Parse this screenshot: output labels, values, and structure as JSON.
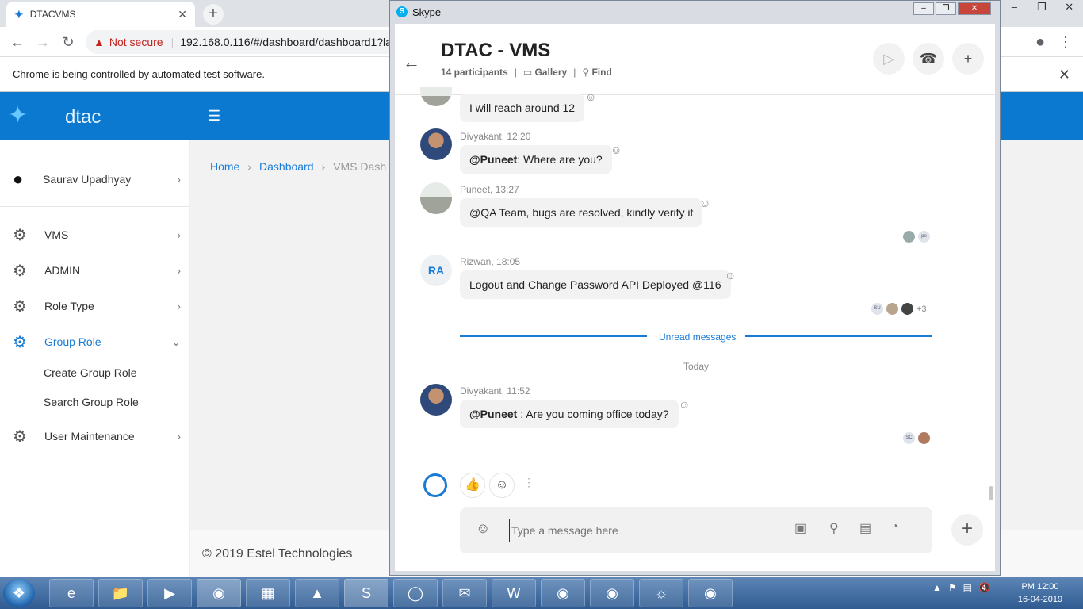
{
  "browser": {
    "tab_title": "DTACVMS",
    "not_secure": "Not secure",
    "url": "192.168.0.116/#/dashboard/dashboard1?la",
    "infobar_text": "Chrome is being controlled by automated test software."
  },
  "app": {
    "brand": "dtac",
    "user_name": "Saurav Upadhyay",
    "menu": [
      {
        "label": "VMS"
      },
      {
        "label": "ADMIN"
      },
      {
        "label": "Role Type"
      },
      {
        "label": "Group Role"
      },
      {
        "label": "User Maintenance"
      }
    ],
    "submenu": [
      {
        "label": "Create Group Role"
      },
      {
        "label": "Search Group Role"
      }
    ],
    "breadcrumb": {
      "home": "Home",
      "dashboard": "Dashboard",
      "current": "VMS Dash"
    },
    "footer": "© 2019 Estel Technologies"
  },
  "skype": {
    "window_title": "Skype",
    "conversation_title": "DTAC - VMS",
    "participants": "14 participants",
    "gallery": "Gallery",
    "find": "Find",
    "messages": [
      {
        "sender": "",
        "text": "I will reach around 12",
        "mention": ""
      },
      {
        "sender": "Divyakant, 12:20",
        "mention": "@Puneet",
        "text": ": Where are you?"
      },
      {
        "sender": "Puneet, 13:27",
        "mention": "",
        "text": "@QA Team, bugs are resolved, kindly verify it"
      },
      {
        "sender": "Rizwan, 18:05",
        "mention": "",
        "text": "Logout and Change Password API Deployed @116",
        "avatar_initials": "RA"
      },
      {
        "sender": "Divyakant, 11:52",
        "mention": "@Puneet",
        "text": " : Are you coming office today?"
      }
    ],
    "read_receipts": {
      "msg3": [
        "",
        "pe"
      ],
      "msg4": [
        "SU",
        "",
        "",
        "+3"
      ],
      "msg5": [
        "SC",
        ""
      ]
    },
    "unread_label": "Unread messages",
    "today_label": "Today",
    "composer_placeholder": "Type a message here"
  },
  "taskbar": {
    "clock_time": "PM 12:00",
    "clock_date": "16-04-2019"
  }
}
